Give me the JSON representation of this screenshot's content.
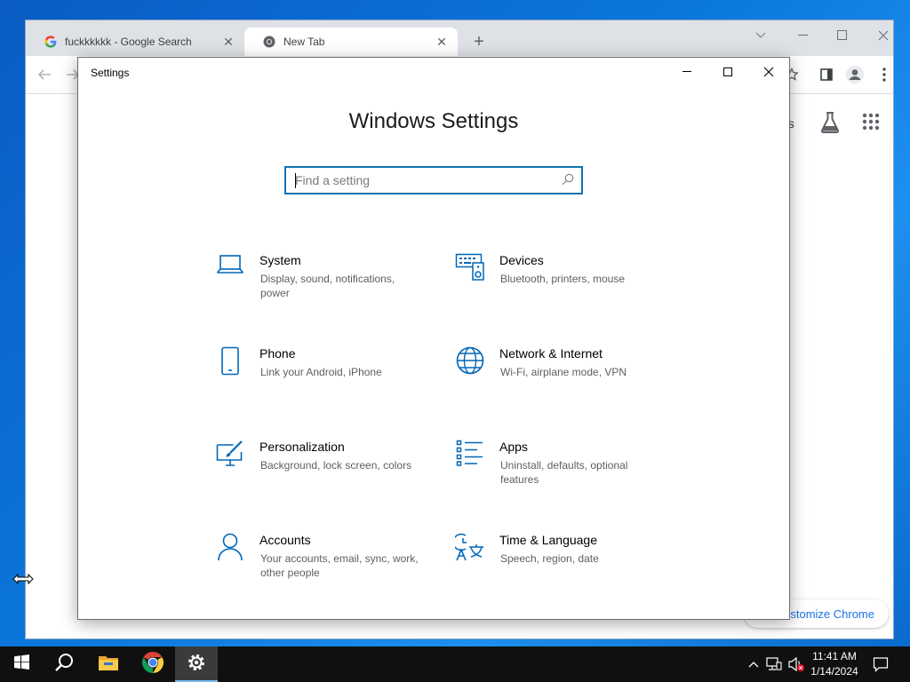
{
  "chrome": {
    "tabs": [
      {
        "title": "fuckkkkkk - Google Search",
        "icon": "google-g-icon",
        "active": false
      },
      {
        "title": "New Tab",
        "icon": "chrome-icon",
        "active": true
      }
    ],
    "ntp_partial_text": "es",
    "customize_label": "Customize Chrome"
  },
  "settings": {
    "window_title": "Settings",
    "heading": "Windows Settings",
    "search_placeholder": "Find a setting",
    "accent_color": "#0067b8",
    "categories": [
      {
        "name": "System",
        "desc": "Display, sound, notifications, power",
        "icon": "laptop-icon"
      },
      {
        "name": "Devices",
        "desc": "Bluetooth, printers, mouse",
        "icon": "keyboard-speaker-icon"
      },
      {
        "name": "Phone",
        "desc": "Link your Android, iPhone",
        "icon": "phone-icon"
      },
      {
        "name": "Network & Internet",
        "desc": "Wi-Fi, airplane mode, VPN",
        "icon": "globe-icon"
      },
      {
        "name": "Personalization",
        "desc": "Background, lock screen, colors",
        "icon": "paint-brush-icon"
      },
      {
        "name": "Apps",
        "desc": "Uninstall, defaults, optional features",
        "icon": "apps-list-icon"
      },
      {
        "name": "Accounts",
        "desc": "Your accounts, email, sync, work, other people",
        "icon": "person-icon"
      },
      {
        "name": "Time & Language",
        "desc": "Speech, region, date",
        "icon": "time-language-icon"
      }
    ]
  },
  "taskbar": {
    "time": "11:41 AM",
    "date": "1/14/2024"
  }
}
